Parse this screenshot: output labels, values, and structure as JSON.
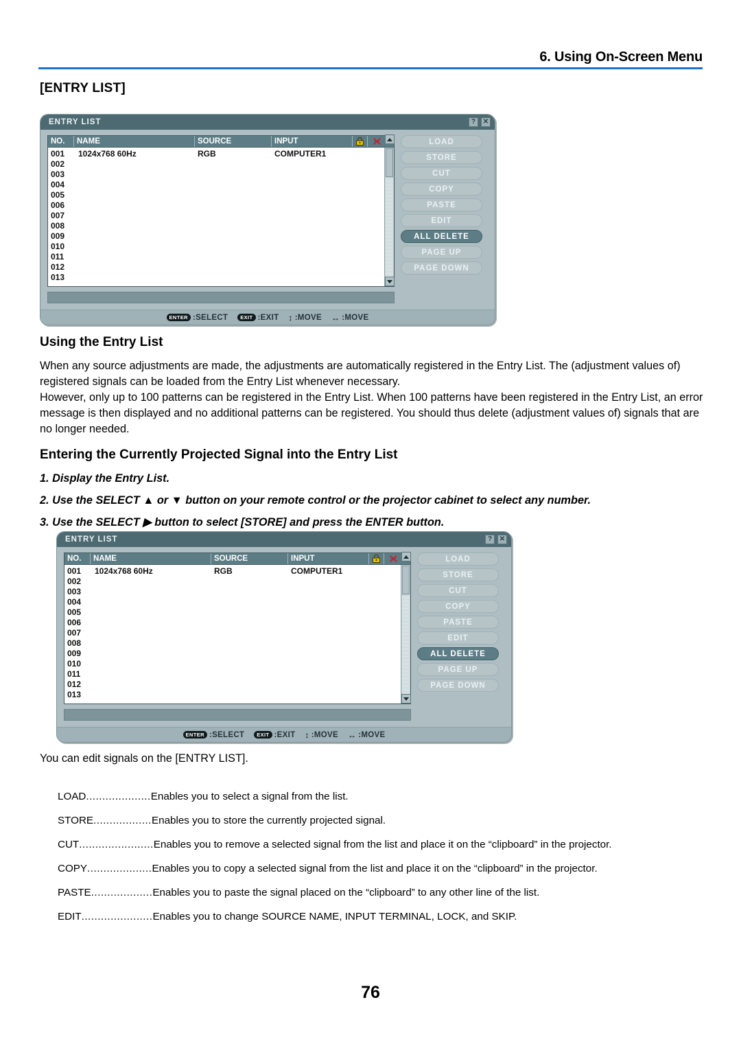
{
  "header": {
    "chapter_title": "6. Using On-Screen Menu",
    "rule_color": "#1f6fd0"
  },
  "bracket_title": "[ENTRY LIST]",
  "sections": {
    "using_title": "Using the Entry List",
    "para1": "When any source adjustments are made, the adjustments are automatically registered in the Entry List. The (adjustment values of) registered signals can be loaded from the Entry List whenever necessary.",
    "para2": "However, only up to 100 patterns can be registered in the Entry List. When 100 patterns have been registered in the Entry List, an error message is then displayed and no additional patterns can be registered. You should thus delete (adjustment values of) signals that are no longer needed.",
    "entering_title": "Entering the Currently Projected Signal into the Entry List",
    "steps": [
      "1. Display the Entry List.",
      "2. Use the SELECT ▲ or ▼ button on your remote control or the projector cabinet to select any number.",
      "3. Use the SELECT ▶ button to select [STORE] and press the ENTER button."
    ],
    "edit_note": "You can edit signals on the [ENTRY LIST]."
  },
  "definitions": [
    {
      "term": "LOAD",
      "dots": "....................",
      "desc": "Enables you to select a signal from the list."
    },
    {
      "term": "STORE",
      "dots": "..................",
      "desc": "Enables you to store the currently projected signal."
    },
    {
      "term": "CUT",
      "dots": ".......................",
      "desc": "Enables you to remove a selected signal from the list and place it on the “clipboard” in the projector."
    },
    {
      "term": "COPY",
      "dots": "....................",
      "desc": "Enables you to copy a selected signal from the list and place it on the “clipboard” in the projector."
    },
    {
      "term": "PASTE",
      "dots": "...................",
      "desc": "Enables you to paste the signal placed on the “clipboard” to any other line of the list."
    },
    {
      "term": "EDIT",
      "dots": "......................",
      "desc": "Enables you to change SOURCE NAME, INPUT TERMINAL, LOCK, and SKIP."
    }
  ],
  "osd": {
    "title": "ENTRY LIST",
    "help_btn": "?",
    "close_btn": "✕",
    "columns": {
      "no": "NO.",
      "name": "NAME",
      "source": "SOURCE",
      "input": "INPUT",
      "lock_icon": "lock-icon",
      "skip_icon": "skip-icon"
    },
    "rows": [
      {
        "no": "001",
        "name": "1024x768 60Hz",
        "source": "RGB",
        "input": "COMPUTER1"
      },
      {
        "no": "002",
        "name": "",
        "source": "",
        "input": ""
      },
      {
        "no": "003",
        "name": "",
        "source": "",
        "input": ""
      },
      {
        "no": "004",
        "name": "",
        "source": "",
        "input": ""
      },
      {
        "no": "005",
        "name": "",
        "source": "",
        "input": ""
      },
      {
        "no": "006",
        "name": "",
        "source": "",
        "input": ""
      },
      {
        "no": "007",
        "name": "",
        "source": "",
        "input": ""
      },
      {
        "no": "008",
        "name": "",
        "source": "",
        "input": ""
      },
      {
        "no": "009",
        "name": "",
        "source": "",
        "input": ""
      },
      {
        "no": "010",
        "name": "",
        "source": "",
        "input": ""
      },
      {
        "no": "011",
        "name": "",
        "source": "",
        "input": ""
      },
      {
        "no": "012",
        "name": "",
        "source": "",
        "input": ""
      },
      {
        "no": "013",
        "name": "",
        "source": "",
        "input": ""
      }
    ],
    "buttons": [
      {
        "label": "LOAD",
        "selected": false
      },
      {
        "label": "STORE",
        "selected": false
      },
      {
        "label": "CUT",
        "selected": false
      },
      {
        "label": "COPY",
        "selected": false
      },
      {
        "label": "PASTE",
        "selected": false
      },
      {
        "label": "EDIT",
        "selected": false
      },
      {
        "label": "ALL DELETE",
        "selected": true
      },
      {
        "label": "PAGE UP",
        "selected": false
      },
      {
        "label": "PAGE DOWN",
        "selected": false
      }
    ],
    "footer": [
      {
        "key": "ENTER",
        "glyph": "",
        "label": ":SELECT"
      },
      {
        "key": "EXIT",
        "glyph": "",
        "label": ":EXIT"
      },
      {
        "key": "",
        "glyph": "↕",
        "label": ":MOVE"
      },
      {
        "key": "",
        "glyph": "↔",
        "label": ":MOVE"
      }
    ],
    "colors": {
      "titlebar": "#4d6a72",
      "window": "#aebec2",
      "header_row": "#5d7d86",
      "selected_button": "#5d7d86",
      "lock": "#e5c100",
      "skip": "#d41f1f"
    }
  },
  "page_number": "76"
}
